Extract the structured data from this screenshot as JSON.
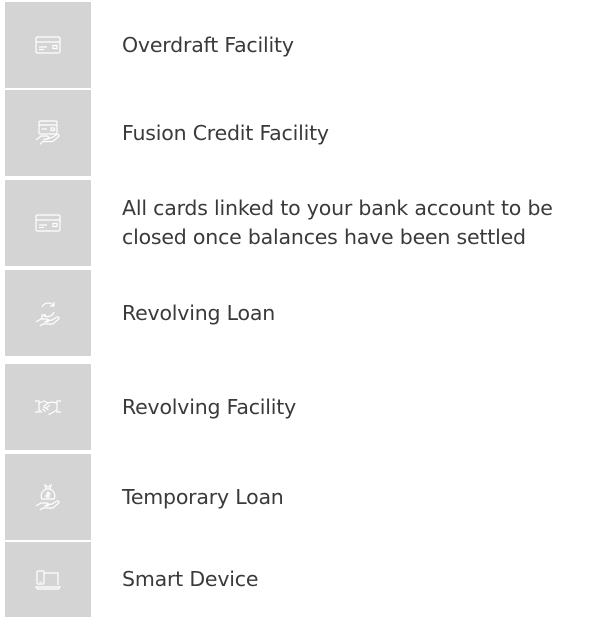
{
  "items": [
    {
      "label": "Overdraft Facility",
      "icon": "card-icon"
    },
    {
      "label": "Fusion Credit Facility",
      "icon": "card-in-hand-icon"
    },
    {
      "label": "All cards linked to your bank account to be closed once balances have been settled",
      "icon": "card-icon"
    },
    {
      "label": "Revolving Loan",
      "icon": "revolving-hand-icon"
    },
    {
      "label": "Revolving Facility",
      "icon": "handshake-icon"
    },
    {
      "label": "Temporary Loan",
      "icon": "money-bag-hand-icon"
    },
    {
      "label": "Smart Device",
      "icon": "devices-icon"
    }
  ],
  "colors": {
    "tile": "#d4d4d4",
    "icon": "#ffffff",
    "text": "#3a3a3a"
  }
}
